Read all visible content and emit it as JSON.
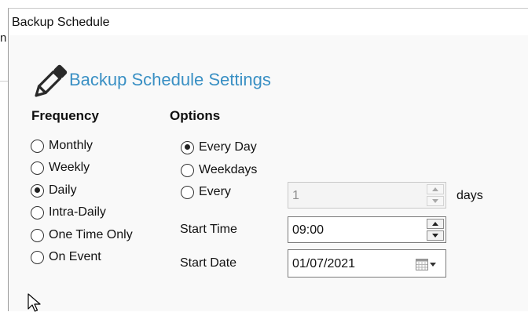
{
  "background": {
    "letter": "n"
  },
  "window": {
    "title": "Backup Schedule"
  },
  "header": {
    "title": "Backup Schedule Settings",
    "icon": "pencil-icon",
    "accent_color": "#3a90c4"
  },
  "frequency": {
    "label": "Frequency",
    "selected": "Daily",
    "options": [
      "Monthly",
      "Weekly",
      "Daily",
      "Intra-Daily",
      "One Time Only",
      "On Event"
    ]
  },
  "options": {
    "label": "Options",
    "selected": "Every Day",
    "choices": [
      "Every Day",
      "Weekdays",
      "Every"
    ],
    "every_days": {
      "value": "1",
      "unit": "days",
      "disabled": true
    },
    "start_time": {
      "label": "Start Time",
      "value": "09:00"
    },
    "start_date": {
      "label": "Start Date",
      "value": "01/07/2021",
      "icon": "calendar-icon"
    }
  }
}
